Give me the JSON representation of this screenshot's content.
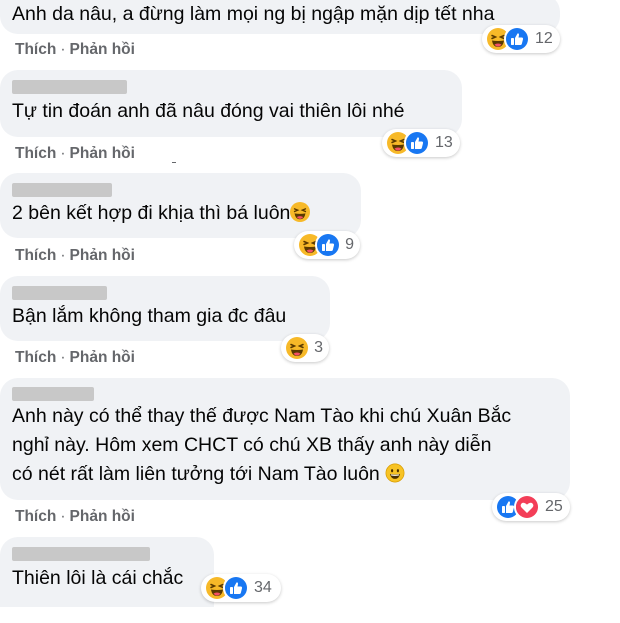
{
  "comments": [
    {
      "text": "Anh da nâu, a đừng làm mọi ng bị ngập mặn dịp tết nha",
      "like_label": "Thích",
      "reply_label": "Phản hồi",
      "reaction_count": "12"
    },
    {
      "text": "Tự tin đoán anh đã nâu đóng vai thiên lôi nhé",
      "like_label": "Thích",
      "reply_label": "Phản hồi",
      "reaction_count": "13"
    },
    {
      "text": "2 bên kết hợp đi khịa thì bá luôn",
      "like_label": "Thích",
      "reply_label": "Phản hồi",
      "reaction_count": "9"
    },
    {
      "text": "Bận lắm không tham gia đc đâu",
      "like_label": "Thích",
      "reply_label": "Phản hồi",
      "reaction_count": "3"
    },
    {
      "lines": [
        "Anh này có thể thay thế được Nam Tào khi chú Xuân Bắc",
        "nghỉ này. Hôm xem CHCT có chú XB thấy anh này diễn",
        "có nét rất làm liên tưởng tới Nam Tào luôn"
      ],
      "like_label": "Thích",
      "reply_label": "Phản hồi",
      "reaction_count": "25"
    },
    {
      "text": "Thiên lôi là cái chắc",
      "reaction_count": "34"
    }
  ],
  "dot": "·",
  "colors": {
    "bubble": "#f0f2f5",
    "action_text": "#65676b",
    "like": "#1877f2",
    "haha": "#f7b928",
    "love": "#f33e58"
  },
  "icons": [
    "haha-icon",
    "like-icon",
    "love-icon",
    "laughing-tears-emoji",
    "smiling-emoji"
  ]
}
